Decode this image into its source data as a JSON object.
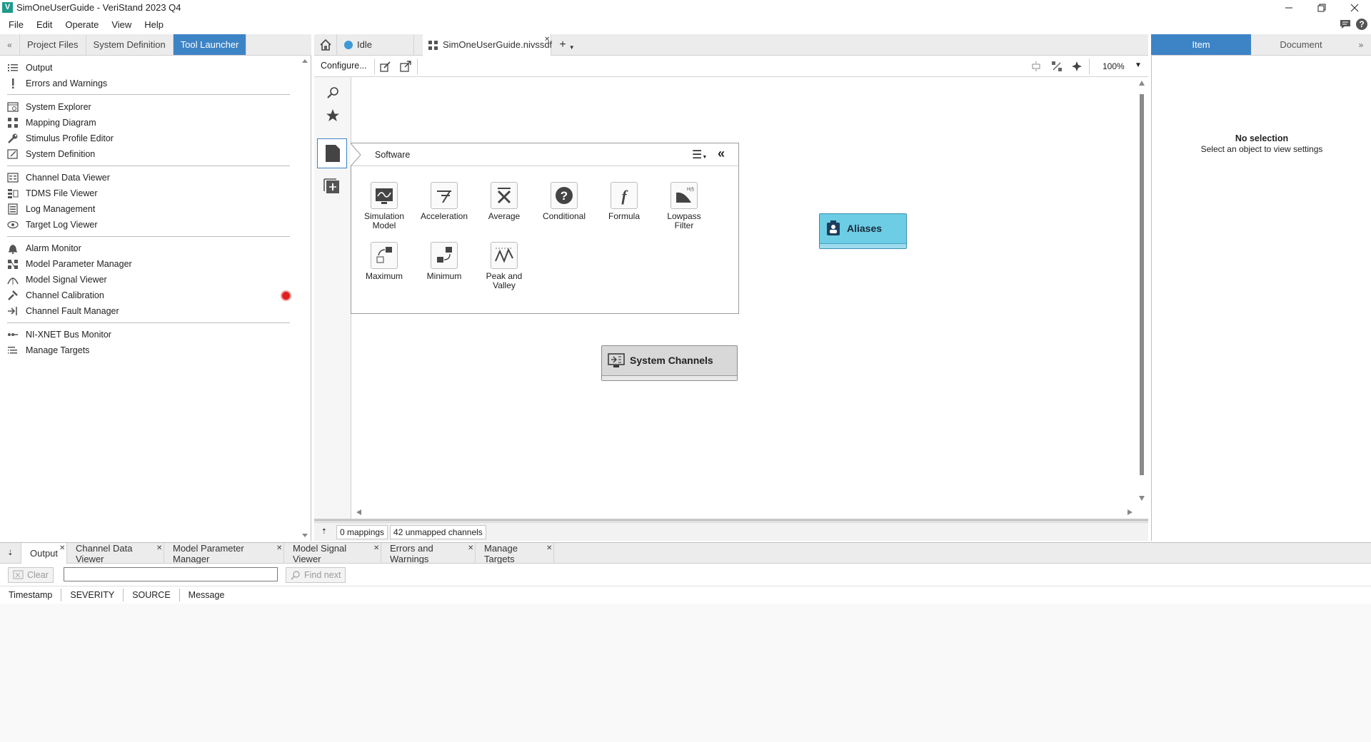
{
  "window": {
    "title": "SimOneUserGuide - VeriStand 2023 Q4",
    "logo_letter": "V"
  },
  "menu": [
    "File",
    "Edit",
    "Operate",
    "View",
    "Help"
  ],
  "left_panel": {
    "tabs": [
      "Project Files",
      "System Definition",
      "Tool Launcher"
    ],
    "active_tab": "Tool Launcher",
    "groups": [
      [
        {
          "label": "Output",
          "icon": "list-icon"
        },
        {
          "label": "Errors and Warnings",
          "icon": "exclamation-icon"
        }
      ],
      [
        {
          "label": "System Explorer",
          "icon": "explorer-icon"
        },
        {
          "label": "Mapping Diagram",
          "icon": "mapping-icon"
        },
        {
          "label": "Stimulus Profile Editor",
          "icon": "wrench-icon"
        },
        {
          "label": "System Definition",
          "icon": "system-definition-icon"
        }
      ],
      [
        {
          "label": "Channel Data Viewer",
          "icon": "data-viewer-icon"
        },
        {
          "label": "TDMS File Viewer",
          "icon": "tdms-icon"
        },
        {
          "label": "Log Management",
          "icon": "log-icon"
        },
        {
          "label": "Target Log Viewer",
          "icon": "eye-icon"
        }
      ],
      [
        {
          "label": "Alarm Monitor",
          "icon": "bell-icon"
        },
        {
          "label": "Model Parameter Manager",
          "icon": "parameter-icon"
        },
        {
          "label": "Model Signal Viewer",
          "icon": "signal-icon"
        },
        {
          "label": "Channel Calibration",
          "icon": "calibration-icon"
        },
        {
          "label": "Channel Fault Manager",
          "icon": "fault-icon"
        }
      ],
      [
        {
          "label": "NI-XNET Bus Monitor",
          "icon": "bus-icon"
        },
        {
          "label": "Manage Targets",
          "icon": "targets-icon"
        }
      ]
    ],
    "status_color": "#e02020"
  },
  "center": {
    "tabs": [
      {
        "label": "Idle",
        "icon": "status-dot-icon"
      },
      {
        "label": "SimOneUserGuide.nivssdf",
        "icon": "mapping-icon"
      }
    ],
    "toolbar": {
      "configure_label": "Configure...",
      "zoom": "100%"
    },
    "palette": {
      "title": "Software",
      "items": [
        {
          "label": "Simulation\nModel",
          "icon": "simulation-model-icon"
        },
        {
          "label": "Acceleration",
          "icon": "acceleration-icon"
        },
        {
          "label": "Average",
          "icon": "average-icon"
        },
        {
          "label": "Conditional",
          "icon": "conditional-icon"
        },
        {
          "label": "Formula",
          "icon": "formula-icon"
        },
        {
          "label": "Lowpass\nFilter",
          "icon": "lowpass-filter-icon"
        },
        {
          "label": "Maximum",
          "icon": "maximum-icon"
        },
        {
          "label": "Minimum",
          "icon": "minimum-icon"
        },
        {
          "label": "Peak and\nValley",
          "icon": "peak-valley-icon"
        }
      ]
    },
    "nodes": {
      "aliases": "Aliases",
      "system_channels": "System Channels"
    },
    "status": {
      "mappings": "0 mappings",
      "unmapped": "42 unmapped channels"
    }
  },
  "right_panel": {
    "tabs": [
      "Item",
      "Document"
    ],
    "active_tab": "Item",
    "no_selection": "No selection",
    "hint": "Select an object to view settings"
  },
  "bottom": {
    "tabs": [
      "Output",
      "Channel Data Viewer",
      "Model Parameter Manager",
      "Model Signal Viewer",
      "Errors and Warnings",
      "Manage Targets"
    ],
    "active_tab": "Output",
    "clear_label": "Clear",
    "find_next_label": "Find next",
    "search_value": "",
    "columns": [
      "Timestamp",
      "SEVERITY",
      "SOURCE",
      "Message"
    ]
  },
  "colors": {
    "accent": "#3d84c6",
    "aliases_node": "#6ccde5",
    "system_channels_node": "#d8d8d8"
  }
}
